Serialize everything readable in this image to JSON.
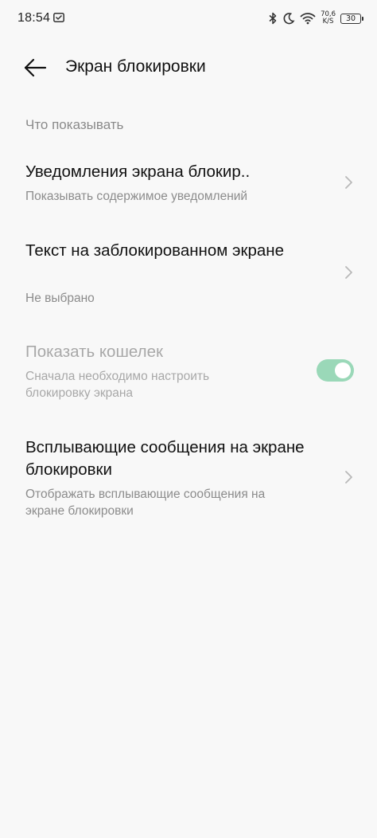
{
  "status_bar": {
    "time": "18:54",
    "net_speed_value": "70,6",
    "net_speed_unit": "K/S",
    "battery": "30"
  },
  "header": {
    "title": "Экран блокировки"
  },
  "section": {
    "header": "Что показывать"
  },
  "items": [
    {
      "title": "Уведомления экрана блокир..",
      "subtitle": "Показывать содержимое уведомлений",
      "control": "chevron"
    },
    {
      "title": "Текст на заблокированном экране",
      "subtitle": "Не выбрано",
      "control": "chevron"
    },
    {
      "title": "Показать кошелек",
      "subtitle": "Сначала необходимо настроить блокировку экрана",
      "control": "toggle",
      "toggle_on": true,
      "disabled": true
    },
    {
      "title": "Всплывающие сообщения на экране блокировки",
      "subtitle": "Отображать всплывающие сообщения на экране блокировки",
      "control": "chevron"
    }
  ],
  "colors": {
    "background": "#f8f8f8",
    "toggle_track": "#9ad8b8",
    "secondary_text": "#8c8c8c",
    "disabled_text": "#a8a8a8"
  }
}
